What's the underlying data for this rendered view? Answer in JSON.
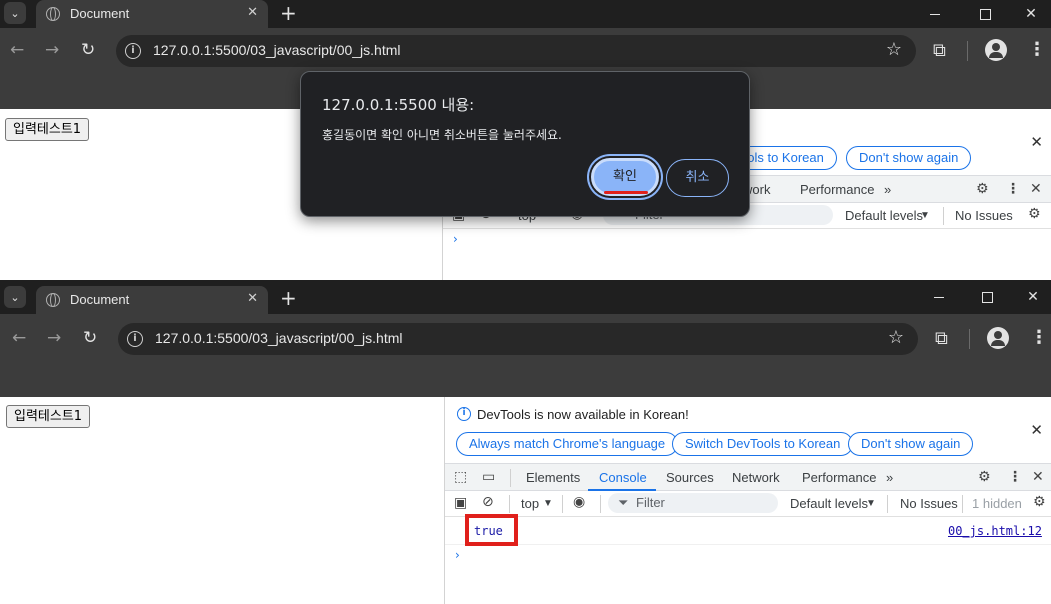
{
  "browser": {
    "tab_title": "Document",
    "tab_close": "✕",
    "new_tab": "+",
    "url": "127.0.0.1:5500/03_javascript/00_js.html"
  },
  "page": {
    "button_label": "입력테스트1"
  },
  "dialog": {
    "title": "127.0.0.1:5500 내용:",
    "message": "홍길동이면 확인 아니면 취소버튼을 눌러주세요.",
    "ok_label": "확인",
    "cancel_label": "취소"
  },
  "devtools": {
    "banner_message": "DevTools is now available in Korean!",
    "always_match": "Always match Chrome's language",
    "switch_korean": "Switch DevTools to Korean",
    "switch_korean_partial": "ools to Korean",
    "dont_show": "Don't show again",
    "tabs": {
      "elements": "Elements",
      "console": "Console",
      "sources": "Sources",
      "network": "Network",
      "network_partial": "work",
      "performance": "Performance",
      "more": "»"
    },
    "console_bar": {
      "context": "top",
      "filter_placeholder": "Filter",
      "levels": "Default levels",
      "issues": "No Issues",
      "hidden": "1 hidden"
    },
    "log": {
      "value": "true",
      "source": "00_js.html:12"
    }
  },
  "colors": {
    "highlight": "#e0201b",
    "accent": "#1a73e8"
  }
}
